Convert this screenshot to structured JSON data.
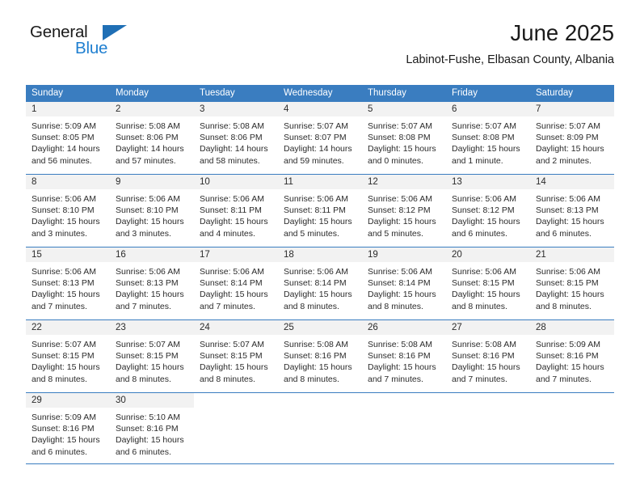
{
  "brand": {
    "word_one": "General",
    "word_two": "Blue",
    "triangle_color": "#1f6fb5",
    "blue_color": "#1f7fd0"
  },
  "header": {
    "title": "June 2025",
    "subtitle": "Labinot-Fushe, Elbasan County, Albania"
  },
  "theme": {
    "header_bg": "#3a7dc0",
    "header_text": "#ffffff",
    "daynum_bg": "#f2f2f2",
    "grid_line": "#3a7dc0",
    "body_text": "#2b2b2b"
  },
  "labels": {
    "sunrise_prefix": "Sunrise: ",
    "sunset_prefix": "Sunset: ",
    "daylight_prefix": "Daylight: "
  },
  "weekdays": [
    "Sunday",
    "Monday",
    "Tuesday",
    "Wednesday",
    "Thursday",
    "Friday",
    "Saturday"
  ],
  "weeks": [
    [
      {
        "day": "1",
        "sunrise": "Sunrise: 5:09 AM",
        "sunset": "Sunset: 8:05 PM",
        "daylight": "Daylight: 14 hours and 56 minutes."
      },
      {
        "day": "2",
        "sunrise": "Sunrise: 5:08 AM",
        "sunset": "Sunset: 8:06 PM",
        "daylight": "Daylight: 14 hours and 57 minutes."
      },
      {
        "day": "3",
        "sunrise": "Sunrise: 5:08 AM",
        "sunset": "Sunset: 8:06 PM",
        "daylight": "Daylight: 14 hours and 58 minutes."
      },
      {
        "day": "4",
        "sunrise": "Sunrise: 5:07 AM",
        "sunset": "Sunset: 8:07 PM",
        "daylight": "Daylight: 14 hours and 59 minutes."
      },
      {
        "day": "5",
        "sunrise": "Sunrise: 5:07 AM",
        "sunset": "Sunset: 8:08 PM",
        "daylight": "Daylight: 15 hours and 0 minutes."
      },
      {
        "day": "6",
        "sunrise": "Sunrise: 5:07 AM",
        "sunset": "Sunset: 8:08 PM",
        "daylight": "Daylight: 15 hours and 1 minute."
      },
      {
        "day": "7",
        "sunrise": "Sunrise: 5:07 AM",
        "sunset": "Sunset: 8:09 PM",
        "daylight": "Daylight: 15 hours and 2 minutes."
      }
    ],
    [
      {
        "day": "8",
        "sunrise": "Sunrise: 5:06 AM",
        "sunset": "Sunset: 8:10 PM",
        "daylight": "Daylight: 15 hours and 3 minutes."
      },
      {
        "day": "9",
        "sunrise": "Sunrise: 5:06 AM",
        "sunset": "Sunset: 8:10 PM",
        "daylight": "Daylight: 15 hours and 3 minutes."
      },
      {
        "day": "10",
        "sunrise": "Sunrise: 5:06 AM",
        "sunset": "Sunset: 8:11 PM",
        "daylight": "Daylight: 15 hours and 4 minutes."
      },
      {
        "day": "11",
        "sunrise": "Sunrise: 5:06 AM",
        "sunset": "Sunset: 8:11 PM",
        "daylight": "Daylight: 15 hours and 5 minutes."
      },
      {
        "day": "12",
        "sunrise": "Sunrise: 5:06 AM",
        "sunset": "Sunset: 8:12 PM",
        "daylight": "Daylight: 15 hours and 5 minutes."
      },
      {
        "day": "13",
        "sunrise": "Sunrise: 5:06 AM",
        "sunset": "Sunset: 8:12 PM",
        "daylight": "Daylight: 15 hours and 6 minutes."
      },
      {
        "day": "14",
        "sunrise": "Sunrise: 5:06 AM",
        "sunset": "Sunset: 8:13 PM",
        "daylight": "Daylight: 15 hours and 6 minutes."
      }
    ],
    [
      {
        "day": "15",
        "sunrise": "Sunrise: 5:06 AM",
        "sunset": "Sunset: 8:13 PM",
        "daylight": "Daylight: 15 hours and 7 minutes."
      },
      {
        "day": "16",
        "sunrise": "Sunrise: 5:06 AM",
        "sunset": "Sunset: 8:13 PM",
        "daylight": "Daylight: 15 hours and 7 minutes."
      },
      {
        "day": "17",
        "sunrise": "Sunrise: 5:06 AM",
        "sunset": "Sunset: 8:14 PM",
        "daylight": "Daylight: 15 hours and 7 minutes."
      },
      {
        "day": "18",
        "sunrise": "Sunrise: 5:06 AM",
        "sunset": "Sunset: 8:14 PM",
        "daylight": "Daylight: 15 hours and 8 minutes."
      },
      {
        "day": "19",
        "sunrise": "Sunrise: 5:06 AM",
        "sunset": "Sunset: 8:14 PM",
        "daylight": "Daylight: 15 hours and 8 minutes."
      },
      {
        "day": "20",
        "sunrise": "Sunrise: 5:06 AM",
        "sunset": "Sunset: 8:15 PM",
        "daylight": "Daylight: 15 hours and 8 minutes."
      },
      {
        "day": "21",
        "sunrise": "Sunrise: 5:06 AM",
        "sunset": "Sunset: 8:15 PM",
        "daylight": "Daylight: 15 hours and 8 minutes."
      }
    ],
    [
      {
        "day": "22",
        "sunrise": "Sunrise: 5:07 AM",
        "sunset": "Sunset: 8:15 PM",
        "daylight": "Daylight: 15 hours and 8 minutes."
      },
      {
        "day": "23",
        "sunrise": "Sunrise: 5:07 AM",
        "sunset": "Sunset: 8:15 PM",
        "daylight": "Daylight: 15 hours and 8 minutes."
      },
      {
        "day": "24",
        "sunrise": "Sunrise: 5:07 AM",
        "sunset": "Sunset: 8:15 PM",
        "daylight": "Daylight: 15 hours and 8 minutes."
      },
      {
        "day": "25",
        "sunrise": "Sunrise: 5:08 AM",
        "sunset": "Sunset: 8:16 PM",
        "daylight": "Daylight: 15 hours and 8 minutes."
      },
      {
        "day": "26",
        "sunrise": "Sunrise: 5:08 AM",
        "sunset": "Sunset: 8:16 PM",
        "daylight": "Daylight: 15 hours and 7 minutes."
      },
      {
        "day": "27",
        "sunrise": "Sunrise: 5:08 AM",
        "sunset": "Sunset: 8:16 PM",
        "daylight": "Daylight: 15 hours and 7 minutes."
      },
      {
        "day": "28",
        "sunrise": "Sunrise: 5:09 AM",
        "sunset": "Sunset: 8:16 PM",
        "daylight": "Daylight: 15 hours and 7 minutes."
      }
    ],
    [
      {
        "day": "29",
        "sunrise": "Sunrise: 5:09 AM",
        "sunset": "Sunset: 8:16 PM",
        "daylight": "Daylight: 15 hours and 6 minutes."
      },
      {
        "day": "30",
        "sunrise": "Sunrise: 5:10 AM",
        "sunset": "Sunset: 8:16 PM",
        "daylight": "Daylight: 15 hours and 6 minutes."
      },
      {
        "day": "",
        "sunrise": "",
        "sunset": "",
        "daylight": ""
      },
      {
        "day": "",
        "sunrise": "",
        "sunset": "",
        "daylight": ""
      },
      {
        "day": "",
        "sunrise": "",
        "sunset": "",
        "daylight": ""
      },
      {
        "day": "",
        "sunrise": "",
        "sunset": "",
        "daylight": ""
      },
      {
        "day": "",
        "sunrise": "",
        "sunset": "",
        "daylight": ""
      }
    ]
  ]
}
